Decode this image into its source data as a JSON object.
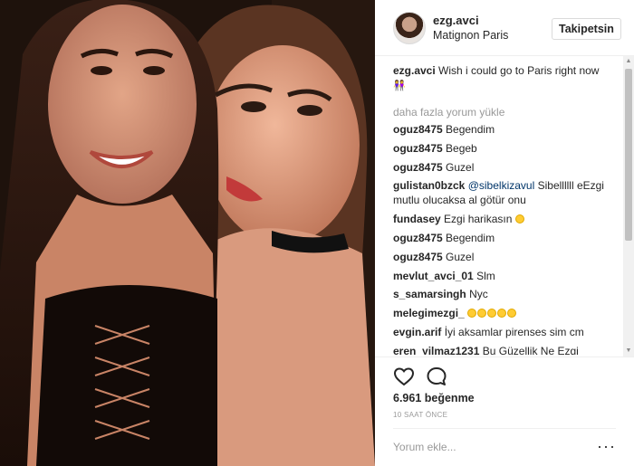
{
  "post": {
    "username": "ezg.avci",
    "location": "Matignon Paris",
    "follow_label": "Takipetsin",
    "caption_user": "ezg.avci",
    "caption_text": "Wish i could go to Paris right now",
    "caption_emoji": "👭"
  },
  "load_more": "daha fazla yorum yükle",
  "comments": [
    {
      "user": "oguz8475",
      "text": "Begendim"
    },
    {
      "user": "oguz8475",
      "text": "Begeb"
    },
    {
      "user": "oguz8475",
      "text": "Guzel"
    },
    {
      "user": "gulistan0bzck",
      "mention": "@sibelkizavul",
      "text": "Sibellllll eEzgi mutlu olucaksa al götür onu"
    },
    {
      "user": "fundasey",
      "text": "Ezgi harikasın"
    },
    {
      "user": "oguz8475",
      "text": "Begendim"
    },
    {
      "user": "oguz8475",
      "text": "Guzel"
    },
    {
      "user": "mevlut_avci_01",
      "text": "Slm"
    },
    {
      "user": "s_samarsingh",
      "text": "Nyc"
    },
    {
      "user": "melegimezgi_",
      "text": ""
    },
    {
      "user": "evgin.arif",
      "text": "İyi aksamlar pirenses sim cm"
    },
    {
      "user": "eren_yilmaz1231",
      "text": "Bu Güzellik Ne Ezgi"
    }
  ],
  "likes": "6.961 beğenme",
  "timestamp": "10 SAAT ÖNCE",
  "comment_placeholder": "Yorum ekle...",
  "icons": {
    "like": "heart-outline-icon",
    "comment": "speech-bubble-icon",
    "more": "ellipsis-icon"
  },
  "colors": {
    "text": "#262626",
    "muted": "#999999",
    "mention": "#003569",
    "border": "#dbdbdb"
  }
}
